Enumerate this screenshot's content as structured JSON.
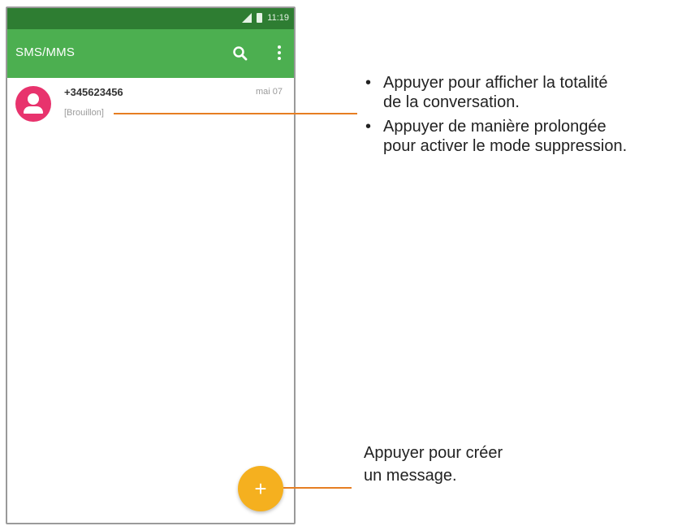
{
  "status_bar": {
    "time": "11:19"
  },
  "app_bar": {
    "title": "SMS/MMS"
  },
  "conversation": {
    "contact": "+345623456",
    "snippet": "[Brouillon]",
    "date": "mai 07"
  },
  "fab": {
    "label": "+"
  },
  "annotations": {
    "top_items": [
      {
        "line1": "Appuyer pour afficher la totalité",
        "line2": "de la conversation."
      },
      {
        "line1": "Appuyer de manière prolongée",
        "line2": "pour activer le mode suppression."
      }
    ],
    "bottom": {
      "line1": "Appuyer pour créer",
      "line2": "un message."
    }
  },
  "colors": {
    "status_bar": "#2e7d32",
    "app_bar": "#4caf50",
    "avatar": "#e8336d",
    "fab": "#f5b01f",
    "callout_line": "#e67e22"
  }
}
